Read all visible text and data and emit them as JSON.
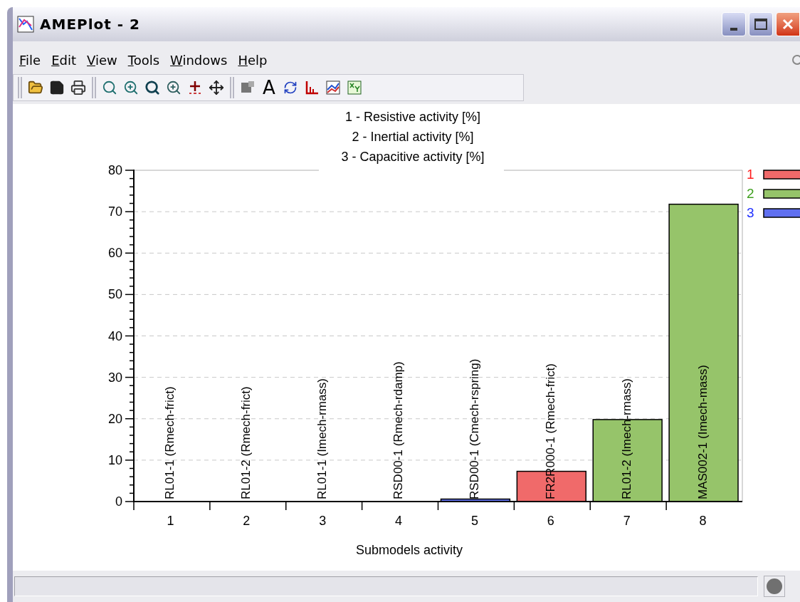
{
  "window": {
    "title": "AMEPlot - 2"
  },
  "menu": [
    {
      "label": "File"
    },
    {
      "label": "Edit"
    },
    {
      "label": "View"
    },
    {
      "label": "Tools"
    },
    {
      "label": "Windows"
    },
    {
      "label": "Help"
    }
  ],
  "toolbar": {
    "text_button": "A"
  },
  "chart": {
    "title_lines": [
      "1 - Resistive activity [%]",
      "2 - Inertial activity [%]",
      "3 - Capacitive activity [%]"
    ],
    "legend": [
      {
        "color": "#ff2020"
      },
      {
        "color": "#40a020"
      },
      {
        "color": "#2030ff"
      }
    ],
    "chart_data": {
      "type": "bar",
      "stacked": true,
      "grid": true,
      "legend": true,
      "xlabel": "Submodels activity",
      "categories": [
        "1",
        "2",
        "3",
        "4",
        "5",
        "6",
        "7",
        "8"
      ],
      "ylim": [
        0,
        80
      ],
      "yticks": [
        0,
        10,
        20,
        30,
        40,
        50,
        60,
        70,
        80
      ],
      "series": [
        {
          "name": "1",
          "color": "#f06a6a",
          "values": [
            0,
            0,
            0,
            0,
            0,
            7.3,
            0,
            0
          ]
        },
        {
          "name": "2",
          "color": "#96c46a",
          "values": [
            0,
            0,
            0,
            0,
            0,
            0,
            19.8,
            71.8
          ]
        },
        {
          "name": "3",
          "color": "#6070f0",
          "values": [
            0,
            0,
            0,
            0,
            0.6,
            0,
            0,
            0
          ]
        }
      ],
      "annotations": [
        "RL01-1 (Rmech-frict)",
        "RL01-2 (Rmech-frict)",
        "RL01-1 (Imech-rmass)",
        "RSD00-1 (Rmech-rdamp)",
        "RSD00-1 (Cmech-rspring)",
        "FR2R000-1 (Rmech-frict)",
        "RL01-2 (Imech-rmass)",
        "MAS002-1 (Imech-mass)"
      ]
    }
  }
}
